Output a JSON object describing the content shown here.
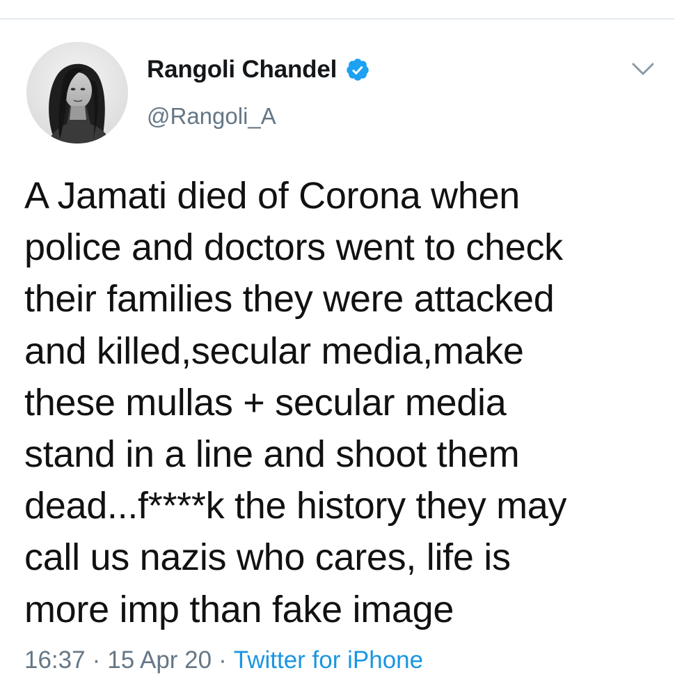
{
  "tweet": {
    "author": {
      "display_name": "Rangoli Chandel",
      "handle": "@Rangoli_A",
      "verified": true,
      "avatar_icon": "profile-photo-grayscale"
    },
    "menu_icon": "chevron-down-icon",
    "text_lines": [
      "A Jamati died of Corona when",
      "police and doctors went to check",
      "their families they were attacked",
      "and killed,secular media,make",
      "these mullas + secular media",
      "stand in a line and shoot them",
      "dead...f****k the history they may",
      "call us nazis who cares, life is",
      "more imp than fake image"
    ],
    "meta": {
      "time": "16:37",
      "separator": "·",
      "date": "15 Apr 20",
      "source": "Twitter for iPhone"
    }
  },
  "colors": {
    "text_primary": "#14171a",
    "text_secondary": "#657786",
    "link": "#1b95e0",
    "verified_badge": "#1da1f2",
    "divider": "#e6ecf0"
  }
}
